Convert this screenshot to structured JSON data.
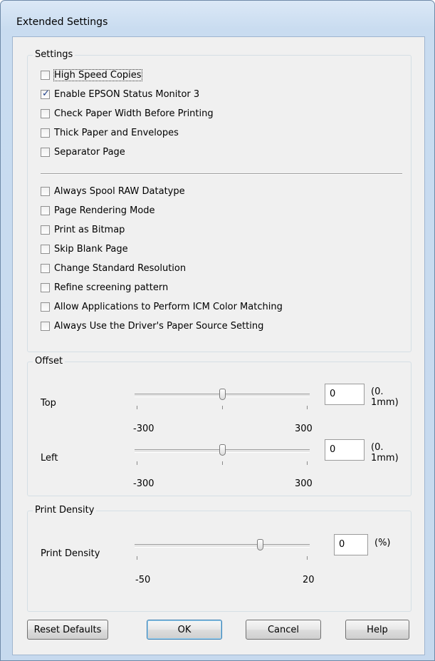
{
  "window": {
    "title": "Extended Settings"
  },
  "settings_group": {
    "legend": "Settings",
    "options_top": [
      {
        "label": "High Speed Copies",
        "checked": false
      },
      {
        "label": "Enable EPSON Status Monitor 3",
        "checked": true
      },
      {
        "label": "Check Paper Width Before Printing",
        "checked": false
      },
      {
        "label": "Thick Paper and Envelopes",
        "checked": false
      },
      {
        "label": "Separator Page",
        "checked": false
      }
    ],
    "options_bottom": [
      {
        "label": "Always Spool RAW Datatype",
        "checked": false
      },
      {
        "label": "Page Rendering Mode",
        "checked": false
      },
      {
        "label": "Print as Bitmap",
        "checked": false
      },
      {
        "label": "Skip Blank Page",
        "checked": false
      },
      {
        "label": "Change Standard Resolution",
        "checked": false
      },
      {
        "label": "Refine screening pattern",
        "checked": false
      },
      {
        "label": "Allow Applications to Perform ICM Color Matching",
        "checked": false
      },
      {
        "label": "Always Use the Driver's Paper Source Setting",
        "checked": false
      }
    ]
  },
  "offset_group": {
    "legend": "Offset",
    "top": {
      "label": "Top",
      "min": "-300",
      "max": "300",
      "value": "0",
      "unit": "(0. 1mm)"
    },
    "left": {
      "label": "Left",
      "min": "-300",
      "max": "300",
      "value": "0",
      "unit": "(0. 1mm)"
    }
  },
  "density_group": {
    "legend": "Print Density",
    "density": {
      "label": "Print Density",
      "min": "-50",
      "max": "20",
      "value": "0",
      "unit": "(%)"
    }
  },
  "buttons": {
    "reset": "Reset Defaults",
    "ok": "OK",
    "cancel": "Cancel",
    "help": "Help"
  }
}
